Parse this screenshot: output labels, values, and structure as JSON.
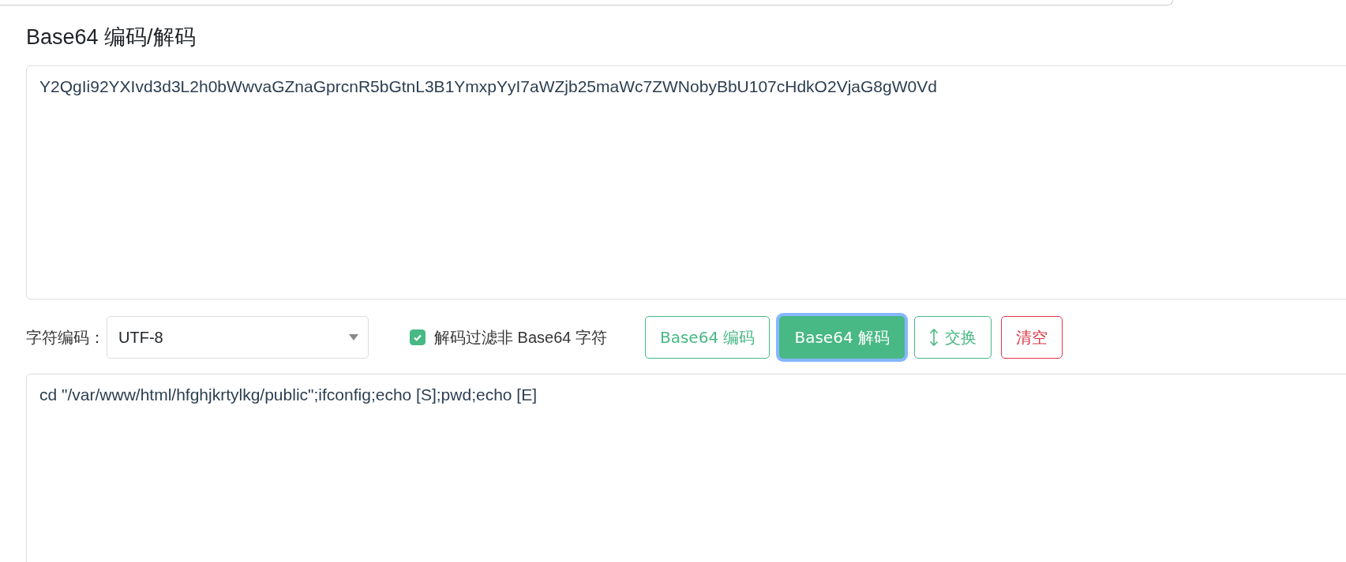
{
  "title": "Base64 编码/解码",
  "input": {
    "value": "Y2QgIi92YXIvd3d3L2h0bWwvaGZnaGprcnR5bGtnL3B1YmxpYyI7aWZjb25maWc7ZWNobyBbU107cHdkO2VjaG8gW0Vd"
  },
  "charset": {
    "label": "字符编码：",
    "value": "UTF-8"
  },
  "filter": {
    "label": "解码过滤非 Base64 字符",
    "checked": true
  },
  "buttons": [
    {
      "label": "Base64 编码",
      "kind": "outline",
      "focused": false
    },
    {
      "label": "Base64 解码",
      "kind": "solid",
      "focused": true
    },
    {
      "label": "交换",
      "kind": "swap",
      "focused": false
    },
    {
      "label": "清空",
      "kind": "danger",
      "focused": false
    }
  ],
  "output": {
    "value": "cd \"/var/www/html/hfghjkrtylkg/public\";ifconfig;echo [S];pwd;echo [E]"
  }
}
